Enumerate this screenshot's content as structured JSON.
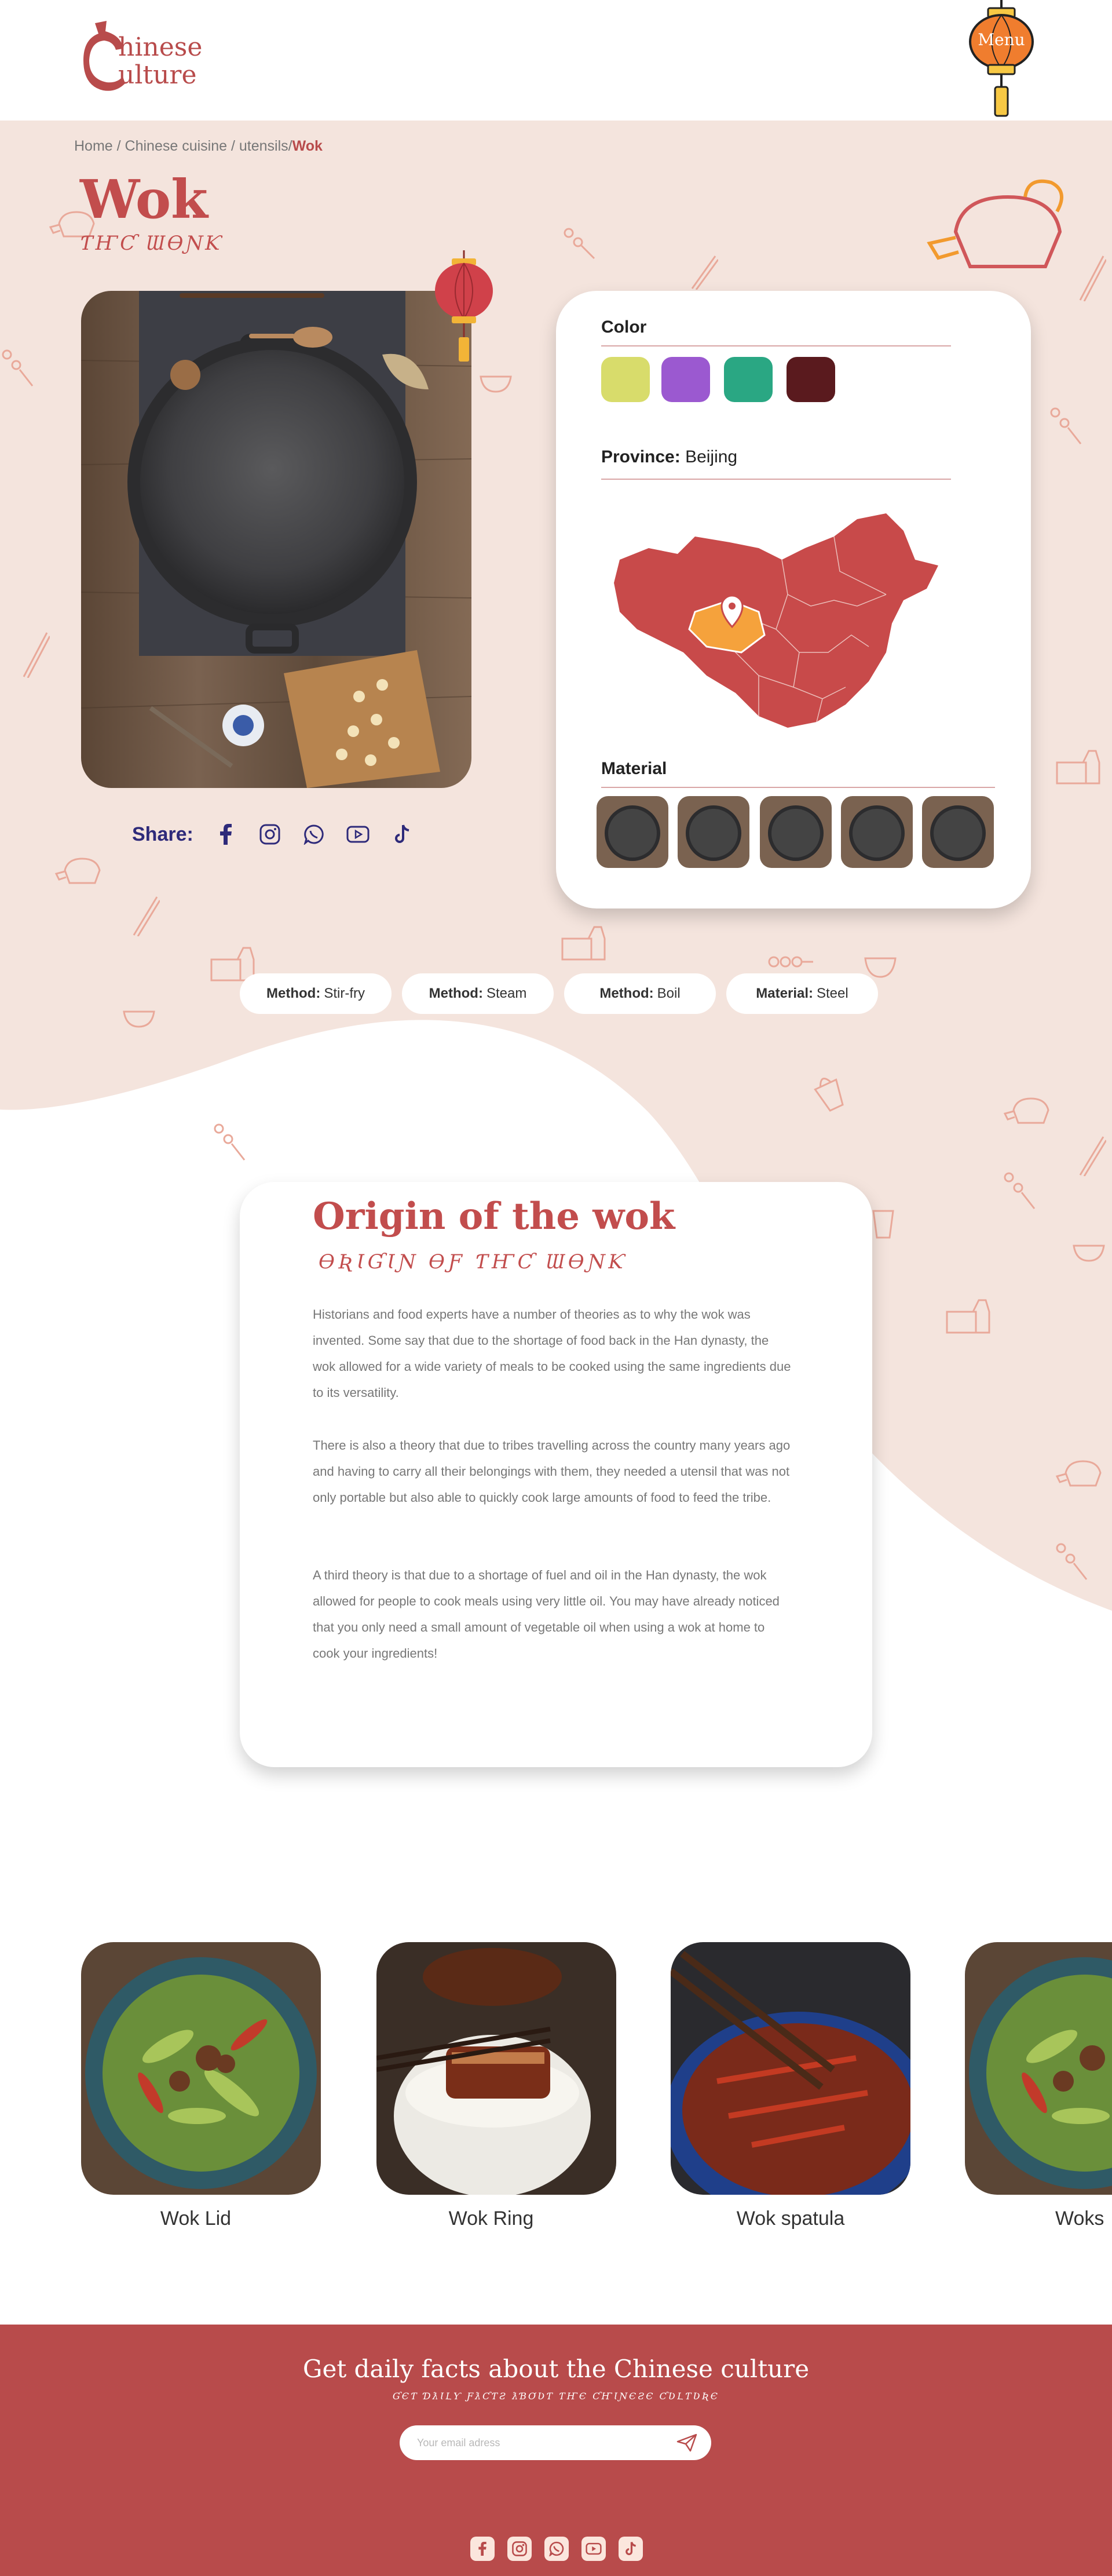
{
  "header": {
    "logo_line1": "hinese",
    "logo_line2": "ulture",
    "menu_label": "Menu"
  },
  "breadcrumb": {
    "items": [
      "Home",
      "Chinese cuisine",
      "utensils/"
    ],
    "current": "Wok",
    "separator": " / "
  },
  "hero": {
    "title": "Wok",
    "subtitle": "ƬҤƇ ƜƟƝƘ"
  },
  "share": {
    "label": "Share:",
    "icons": [
      "facebook-icon",
      "instagram-icon",
      "whatsapp-icon",
      "youtube-icon",
      "tiktok-icon"
    ]
  },
  "info": {
    "color_label": "Color",
    "colors": [
      "#d8dc6b",
      "#9b59d0",
      "#2aa783",
      "#5a1a1e"
    ],
    "province_label": "Province:",
    "province_value": "Beijing",
    "material_label": "Material"
  },
  "tags": [
    {
      "key": "Method:",
      "value": "Stir-fry"
    },
    {
      "key": "Method:",
      "value": "Steam"
    },
    {
      "key": "Method:",
      "value": "Boil"
    },
    {
      "key": "Material:",
      "value": "Steel"
    }
  ],
  "origin": {
    "title": "Origin of the wok",
    "subtitle": "ƟƦƖƓƖƝ ƟƑ ƬҤƇ ƜƟƝƘ",
    "paragraphs": [
      "Historians and food experts have a number of theories as to why the wok was invented. Some say that due to the shortage of food back in the Han dynasty, the wok allowed for a wide variety of meals to be cooked using the same ingredients due to its versatility.",
      "There is also a theory that due to tribes travelling across the country many years ago and having to carry all their belongings with them, they needed a utensil that was not only portable but also able to quickly cook large amounts of food to feed the tribe.",
      "A third theory is that due to a shortage of fuel and oil in the Han dynasty, the wok allowed for people to cook meals using very little oil. You may have already noticed that you only need a small amount of vegetable oil when using a wok at home to cook your ingredients!"
    ]
  },
  "dishes": [
    "Wok Lid",
    "Wok Ring",
    "Wok spatula",
    "Woks"
  ],
  "footer": {
    "title": "Get daily facts about the Chinese culture",
    "subtitle": "ƓЄƬ ƊƛƖԼƳ ƑƛƇƬƧ ƛƁƠƲƬ ƬҤЄ ƇҤƖƝЄƧЄ ƇƲԼƬƲƦЄ",
    "email_placeholder": "Your email adress",
    "socials": [
      "facebook-icon",
      "instagram-icon",
      "whatsapp-icon",
      "youtube-icon",
      "tiktok-icon"
    ]
  },
  "colors": {
    "brand_red": "#b84b4b",
    "title_red": "#c24d4d",
    "hero_bg": "#f4e4dd",
    "share_navy": "#2e2a7a",
    "highlight_orange": "#f5a23c"
  }
}
